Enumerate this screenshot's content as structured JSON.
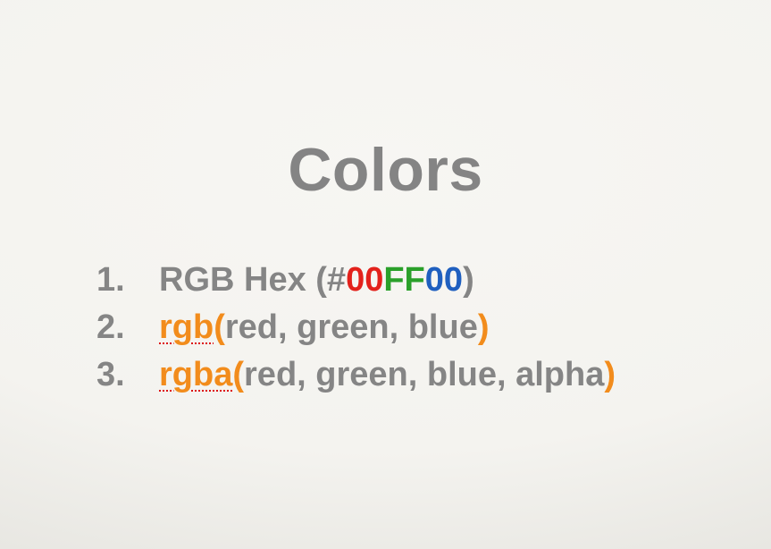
{
  "slide": {
    "title": "Colors",
    "items": [
      {
        "number": "1.",
        "parts": [
          {
            "text": "RGB Hex (#",
            "color": "#858585"
          },
          {
            "text": "00",
            "color": "#e3211b"
          },
          {
            "text": "FF",
            "color": "#2aa02a"
          },
          {
            "text": "00",
            "color": "#1f5fbf"
          },
          {
            "text": ")",
            "color": "#858585"
          }
        ]
      },
      {
        "number": "2.",
        "parts": [
          {
            "text": "rgb",
            "color": "#f28c1c",
            "underline": true
          },
          {
            "text": "(",
            "color": "#f28c1c"
          },
          {
            "text": "red, green, blue",
            "color": "#858585"
          },
          {
            "text": ")",
            "color": "#f28c1c"
          }
        ]
      },
      {
        "number": "3.",
        "parts": [
          {
            "text": "rgba",
            "color": "#f28c1c",
            "underline": true
          },
          {
            "text": "(",
            "color": "#f28c1c"
          },
          {
            "text": "red, green, blue, alpha",
            "color": "#858585"
          },
          {
            "text": ")",
            "color": "#f28c1c"
          }
        ]
      }
    ]
  }
}
